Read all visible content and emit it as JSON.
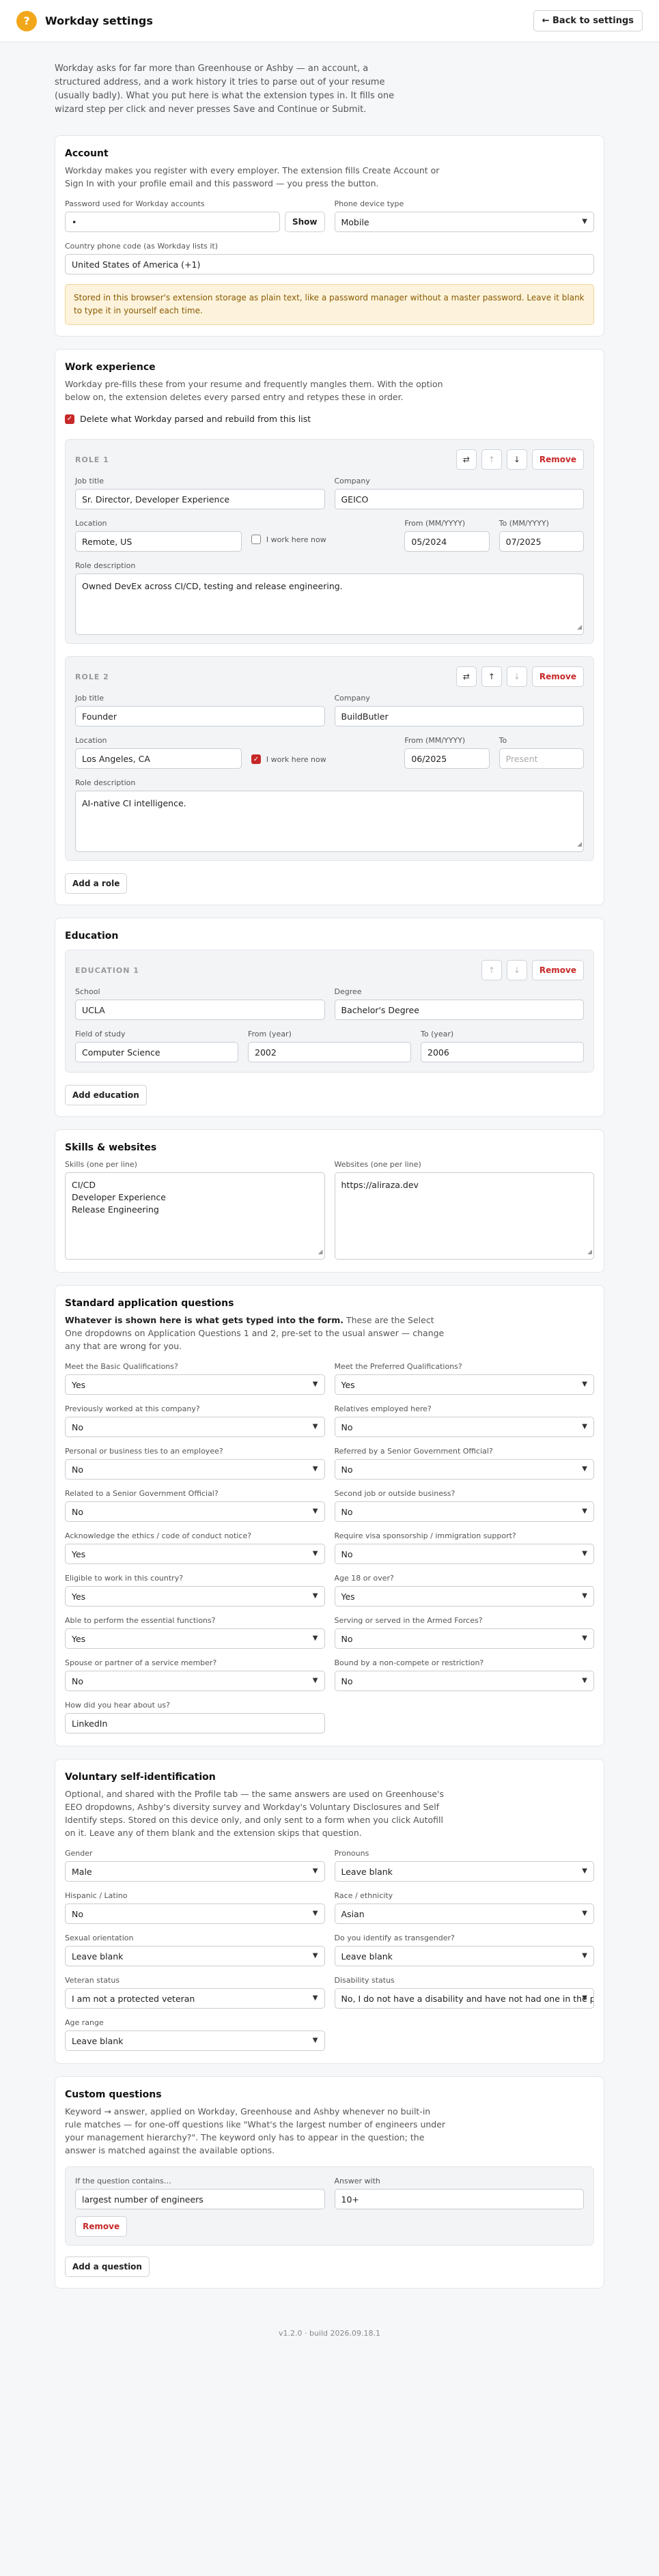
{
  "header": {
    "logo_glyph": "?",
    "title": "Workday settings",
    "back_label": "← Back to settings"
  },
  "intro": "Workday asks for far more than Greenhouse or Ashby — an account, a structured address, and a work history it tries to parse out of your resume (usually badly). What you put here is what the extension types in. It fills one wizard step per click and never presses Save and Continue or Submit.",
  "account": {
    "title": "Account",
    "desc": "Workday makes you register with every employer. The extension fills Create Account or Sign In with your profile email and this password — you press the button.",
    "password_label": "Password used for Workday accounts",
    "password_value": "•",
    "show_label": "Show",
    "device_label": "Phone device type",
    "device_value": "Mobile",
    "country_label": "Country phone code (as Workday lists it)",
    "country_value": "United States of America (+1)",
    "warning": "Stored in this browser's extension storage as plain text, like a password manager without a master password. Leave it blank to type it in yourself each time."
  },
  "work": {
    "title": "Work experience",
    "desc": "Workday pre-fills these from your resume and frequently mangles them. With the option below on, the extension deletes every parsed entry and retypes these in order.",
    "delete_label": "Delete what Workday parsed and rebuild from this list",
    "job_label": "Job title",
    "company_label": "Company",
    "location_label": "Location",
    "current_label": "I work here now",
    "from_label": "From (MM/YYYY)",
    "to_label": "To (MM/YYYY)",
    "to_short": "To",
    "desc_label": "Role description",
    "remove_label": "Remove",
    "roles": [
      {
        "heading": "ROLE 1",
        "job": "Sr. Director, Developer Experience",
        "company": "GEICO",
        "location": "Remote, US",
        "from": "05/2024",
        "to": "07/2025",
        "description": "Owned DevEx across CI/CD, testing and release engineering."
      },
      {
        "heading": "ROLE 2",
        "job": "Founder",
        "company": "BuildButler",
        "location": "Los Angeles, CA",
        "from": "06/2025",
        "to_placeholder": "Present",
        "description": "AI-native CI intelligence."
      }
    ],
    "add_label": "Add a role"
  },
  "education": {
    "title": "Education",
    "heading": "EDUCATION 1",
    "remove_label": "Remove",
    "school_label": "School",
    "school": "UCLA",
    "degree_label": "Degree",
    "degree": "Bachelor's Degree",
    "field_label": "Field of study",
    "field": "Computer Science",
    "from_label": "From (year)",
    "from": "2002",
    "to_label": "To (year)",
    "to": "2006",
    "add_label": "Add education"
  },
  "skills": {
    "title": "Skills & websites",
    "skills_label": "Skills (one per line)",
    "skills_value": "CI/CD\nDeveloper Experience\nRelease Engineering",
    "websites_label": "Websites (one per line)",
    "websites_value": "https://aliraza.dev"
  },
  "standard": {
    "title": "Standard application questions",
    "desc_bold": "Whatever is shown here is what gets typed into the form.",
    "desc_rest": " These are the Select One dropdowns on Application Questions 1 and 2, pre-set to the usual answer — change any that are wrong for you.",
    "questions": [
      {
        "label": "Meet the Basic Qualifications?",
        "value": "Yes"
      },
      {
        "label": "Meet the Preferred Qualifications?",
        "value": "Yes"
      },
      {
        "label": "Previously worked at this company?",
        "value": "No"
      },
      {
        "label": "Relatives employed here?",
        "value": "No"
      },
      {
        "label": "Personal or business ties to an employee?",
        "value": "No"
      },
      {
        "label": "Referred by a Senior Government Official?",
        "value": "No"
      },
      {
        "label": "Related to a Senior Government Official?",
        "value": "No"
      },
      {
        "label": "Second job or outside business?",
        "value": "No"
      },
      {
        "label": "Acknowledge the ethics / code of conduct notice?",
        "value": "Yes"
      },
      {
        "label": "Require visa sponsorship / immigration support?",
        "value": "No"
      },
      {
        "label": "Eligible to work in this country?",
        "value": "Yes"
      },
      {
        "label": "Age 18 or over?",
        "value": "Yes"
      },
      {
        "label": "Able to perform the essential functions?",
        "value": "Yes"
      },
      {
        "label": "Serving or served in the Armed Forces?",
        "value": "No"
      },
      {
        "label": "Spouse or partner of a service member?",
        "value": "No"
      },
      {
        "label": "Bound by a non-compete or restriction?",
        "value": "No"
      }
    ],
    "hear_label": "How did you hear about us?",
    "hear_value": "LinkedIn"
  },
  "voluntary": {
    "title": "Voluntary self-identification",
    "desc": "Optional, and shared with the Profile tab — the same answers are used on Greenhouse's EEO dropdowns, Ashby's diversity survey and Workday's Voluntary Disclosures and Self Identify steps. Stored on this device only, and only sent to a form when you click Autofill on it. Leave any of them blank and the extension skips that question.",
    "fields": [
      {
        "label": "Gender",
        "value": "Male"
      },
      {
        "label": "Pronouns",
        "value": "Leave blank"
      },
      {
        "label": "Hispanic / Latino",
        "value": "No"
      },
      {
        "label": "Race / ethnicity",
        "value": "Asian"
      },
      {
        "label": "Sexual orientation",
        "value": "Leave blank"
      },
      {
        "label": "Do you identify as transgender?",
        "value": "Leave blank"
      },
      {
        "label": "Veteran status",
        "value": "I am not a protected veteran"
      },
      {
        "label": "Disability status",
        "value": "No, I do not have a disability and have not had one in the past"
      }
    ],
    "age_label": "Age range",
    "age_value": "Leave blank"
  },
  "custom": {
    "title": "Custom questions",
    "desc": "Keyword → answer, applied on Workday, Greenhouse and Ashby whenever no built-in rule matches — for one-off questions like \"What's the largest number of engineers under your management hierarchy?\". The keyword only has to appear in the question; the answer is matched against the available options.",
    "contains_label": "If the question contains…",
    "contains_value": "largest number of engineers",
    "answer_label": "Answer with",
    "answer_value": "10+",
    "remove_label": "Remove",
    "add_label": "Add a question"
  },
  "footer": "v1.2.0 · build 2026.09.18.1"
}
